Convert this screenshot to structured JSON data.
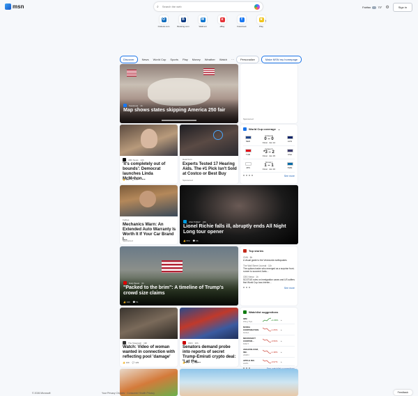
{
  "header": {
    "logo_text": "msn",
    "search_placeholder": "Search the web",
    "location": "Fairfax",
    "temperature": "73°",
    "signin_label": "Sign in"
  },
  "shortcuts": [
    {
      "label": "Outlook.com",
      "color": "#0f6cbd",
      "glyph": "O"
    },
    {
      "label": "Booking.com",
      "color": "#003580",
      "glyph": "B"
    },
    {
      "label": "Walmart",
      "color": "#0071ce",
      "glyph": "W"
    },
    {
      "label": "eBay",
      "color": "#e53238",
      "glyph": "e"
    },
    {
      "label": "Facebook",
      "color": "#1877f2",
      "glyph": "f"
    },
    {
      "label": "Play",
      "color": "#f0c419",
      "glyph": "★"
    }
  ],
  "nav": {
    "items": [
      "Discover",
      "News",
      "World Cup",
      "Sports",
      "Play",
      "Money",
      "Weather",
      "Watch",
      "···"
    ],
    "personalize": "Personalize",
    "homepage": "Make MSN my homepage"
  },
  "hero": {
    "source": "Facebook",
    "age": "1h",
    "title": "Map shows states skipping America 250 fair"
  },
  "ad_top": {
    "sponsored": "Sponsored"
  },
  "cards": {
    "c1": {
      "source": "ABC News",
      "age": "14h",
      "title": "'It's completely out of bounds': Democrat launches Linda McMahon...",
      "likes": "361",
      "comments": "79"
    },
    "c2": {
      "source": "Hear.Com",
      "title": "Experts Tested 17 Hearing Aids. The #1 Pick Isn't Sold at Costco or Best Buy",
      "sponsored": "Sponsored"
    },
    "c3": {
      "source": "Forbes",
      "title": "Mechanics Warn: An Extended Auto Warranty Is Worth It If Your Car Brand I...",
      "sponsored": "Sponsored"
    },
    "c4": {
      "source": "USA TODAY",
      "age": "22h",
      "title": "Lionel Richie falls ill, abruptly ends All Night Long tour opener",
      "likes": "872",
      "comments": "96"
    },
    "c5": {
      "source": "Daily Beast",
      "age": "9h",
      "title": "\"Packed to the brim\": A timeline of Trump's crowd size claims",
      "likes": "144",
      "comments": "51"
    },
    "c6": {
      "source": "The Telegraph",
      "age": "19h",
      "title": "Watch: Video of woman wanted in connection with reflecting pool 'damage'",
      "likes": "109",
      "comments": "429"
    },
    "c7": {
      "source": "CNN",
      "age": "16h",
      "title": "Senators demand probe into reports of secret Trump-Emirati crypto deal: 'Let the...",
      "likes": "671",
      "comments": "98"
    }
  },
  "worldcup": {
    "title": "World Cup coverage",
    "see_more": "See more",
    "matches": [
      {
        "group": "Group E",
        "home": "NED",
        "away": "AUS",
        "score": "0 – 0",
        "status": "Final · Jun 14",
        "home_color": "#21468b",
        "away_color": "#012169"
      },
      {
        "group": "Group F",
        "home": "TUR",
        "away": "USA",
        "score": "*3 – 2",
        "status": "Final · Jun 15",
        "home_color": "#e30a17",
        "away_color": "#3c3b6e"
      },
      {
        "group": "Group I",
        "home": "JPN",
        "away": "SWE",
        "score": "1 – 1",
        "status": "Final · Jun 16",
        "home_color": "#ffffff",
        "away_color": "#006aa7"
      }
    ]
  },
  "top_stories": {
    "title": "Top stories",
    "see_more": "See more",
    "items": [
      {
        "source": "CNN · 6h",
        "text": "A visual guide to the Venezuela earthquakes"
      },
      {
        "source": "The Wall Street Journal · 11h",
        "text": "The options trader who emerged as a surprise front-runner to succeed Janis..."
      },
      {
        "source": "CBS News · 1h",
        "text": "SCOTUS rules on immigration cases and US suffers first World Cup loss Interim..."
      }
    ]
  },
  "watchlist": {
    "title": "Watchlist suggestions",
    "see_more": "See watchlist suggestions",
    "stocks": [
      {
        "name": "IBM",
        "sub": "Wing Tips",
        "price": "",
        "change": "+1.09%",
        "trend": "up"
      },
      {
        "name": "NVIDIA CORPORATION",
        "sub": "NVDA",
        "price": "",
        "change": "-1.05%",
        "trend": "down"
      },
      {
        "name": "MICROSOFT CORPOR...",
        "sub": "MSFT",
        "price": "",
        "change": "-0.56%",
        "trend": "down"
      },
      {
        "name": "AMAZON.COM, INC.",
        "sub": "AMZN",
        "price": "",
        "change": "-1.38%",
        "trend": "down"
      },
      {
        "name": "APPLE INC.",
        "sub": "AAPL",
        "price": "",
        "change": "-0.97%",
        "trend": "down"
      }
    ]
  },
  "footer": {
    "copyright": "© 2026 Microsoft",
    "privacy": "Your Privacy Choices",
    "consumer": "Consumer Health Privacy",
    "feedback": "Feedback"
  }
}
